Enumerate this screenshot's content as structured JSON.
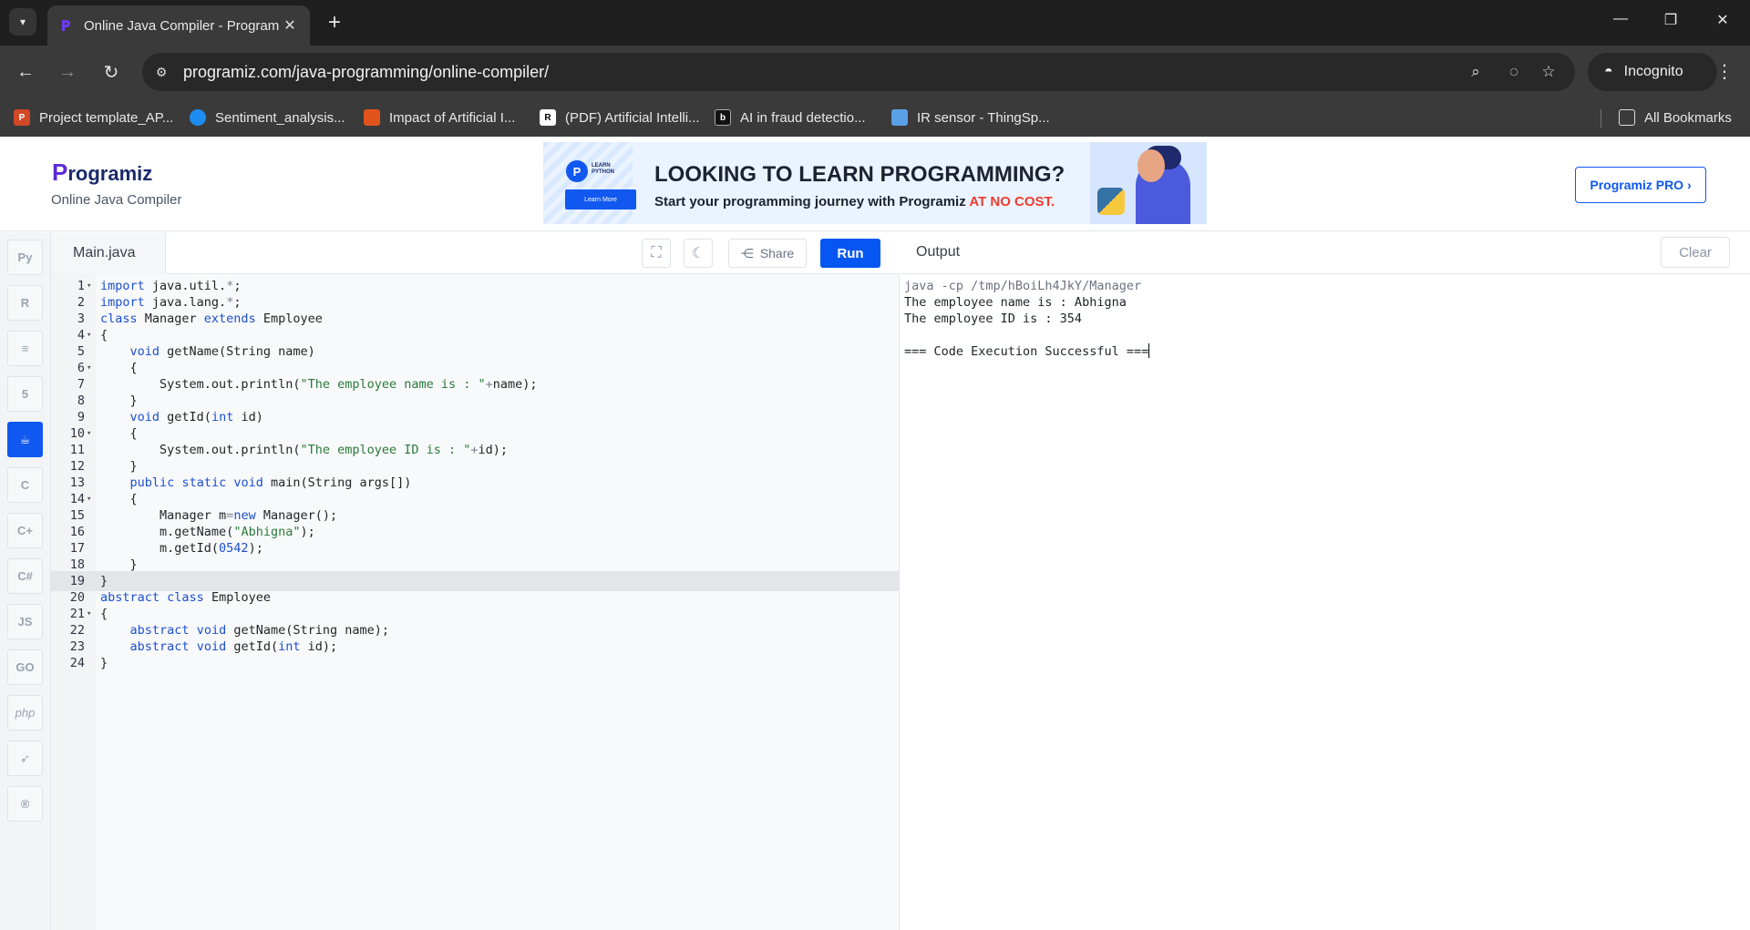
{
  "browser": {
    "tab_title": "Online Java Compiler - Program",
    "url": "programiz.com/java-programming/online-compiler/",
    "incognito_label": "Incognito",
    "all_bookmarks_label": "All Bookmarks",
    "bookmarks": [
      {
        "label": "Project template_AP...",
        "color": "#d24726"
      },
      {
        "label": "Sentiment_analysis...",
        "color": "#1d8cf0"
      },
      {
        "label": "Impact of Artificial I...",
        "color": "#e0541c"
      },
      {
        "label": "(PDF) Artificial Intelli...",
        "color": "#ffffff"
      },
      {
        "label": "AI in fraud detectio...",
        "color": "#111111"
      },
      {
        "label": "IR sensor - ThingSp...",
        "color": "#5aa0e6"
      }
    ]
  },
  "header": {
    "logo_text": "rogramiz",
    "logo_p": "P",
    "subtitle": "Online Java Compiler",
    "banner": {
      "logo_text": "LEARN PYTHON",
      "button": "Learn More",
      "headline": "LOOKING TO LEARN PROGRAMMING?",
      "sub_plain": "Start your programming journey with Programiz ",
      "sub_highlight": "AT NO COST."
    },
    "pro_button": "Programiz PRO ›"
  },
  "languages": [
    {
      "name": "python-icon",
      "glyph": "Py"
    },
    {
      "name": "r-icon",
      "glyph": "R"
    },
    {
      "name": "sql-icon",
      "glyph": "≡"
    },
    {
      "name": "html-icon",
      "glyph": "5"
    },
    {
      "name": "java-icon",
      "glyph": "☕",
      "active": true
    },
    {
      "name": "c-icon",
      "glyph": "C"
    },
    {
      "name": "cpp-icon",
      "glyph": "C+"
    },
    {
      "name": "csharp-icon",
      "glyph": "C#"
    },
    {
      "name": "javascript-icon",
      "glyph": "JS"
    },
    {
      "name": "go-icon",
      "glyph": "GO"
    },
    {
      "name": "php-icon",
      "glyph": "php"
    },
    {
      "name": "swift-icon",
      "glyph": "➶"
    },
    {
      "name": "rust-icon",
      "glyph": "R"
    }
  ],
  "editor": {
    "file_name": "Main.java",
    "share_label": "Share",
    "run_label": "Run",
    "active_line": 19,
    "lines": [
      {
        "n": "1",
        "fold": true,
        "html": "<span class=\"kw\">import</span> java.util.<span class=\"op\">*</span>;"
      },
      {
        "n": "2",
        "fold": false,
        "html": "<span class=\"kw\">import</span> java.lang.<span class=\"op\">*</span>;"
      },
      {
        "n": "3",
        "fold": false,
        "html": "<span class=\"kw\">class</span> Manager <span class=\"kw\">extends</span> Employee"
      },
      {
        "n": "4",
        "fold": true,
        "html": "{"
      },
      {
        "n": "5",
        "fold": false,
        "html": "    <span class=\"kw\">void</span> getName(String name)"
      },
      {
        "n": "6",
        "fold": true,
        "html": "    {"
      },
      {
        "n": "7",
        "fold": false,
        "html": "        System.out.println(<span class=\"str\">\"The employee name is : \"</span><span class=\"op\">+</span>name);"
      },
      {
        "n": "8",
        "fold": false,
        "html": "    }"
      },
      {
        "n": "9",
        "fold": false,
        "html": "    <span class=\"kw\">void</span> getId(<span class=\"kw\">int</span> id)"
      },
      {
        "n": "10",
        "fold": true,
        "html": "    {"
      },
      {
        "n": "11",
        "fold": false,
        "html": "        System.out.println(<span class=\"str\">\"The employee ID is : \"</span><span class=\"op\">+</span>id);"
      },
      {
        "n": "12",
        "fold": false,
        "html": "    }"
      },
      {
        "n": "13",
        "fold": false,
        "html": "    <span class=\"kw\">public</span> <span class=\"kw\">static</span> <span class=\"kw\">void</span> main(String args[])"
      },
      {
        "n": "14",
        "fold": true,
        "html": "    {"
      },
      {
        "n": "15",
        "fold": false,
        "html": "        Manager m<span class=\"op\">=</span><span class=\"kw\">new</span> Manager();"
      },
      {
        "n": "16",
        "fold": false,
        "html": "        m.getName(<span class=\"str\">\"Abhigna\"</span>);"
      },
      {
        "n": "17",
        "fold": false,
        "html": "        m.getId(<span class=\"num\">0542</span>);"
      },
      {
        "n": "18",
        "fold": false,
        "html": "    }"
      },
      {
        "n": "19",
        "fold": false,
        "html": "}"
      },
      {
        "n": "20",
        "fold": false,
        "html": "<span class=\"kw\">abstract</span> <span class=\"kw\">class</span> Employee"
      },
      {
        "n": "21",
        "fold": true,
        "html": "{"
      },
      {
        "n": "22",
        "fold": false,
        "html": "    <span class=\"kw\">abstract</span> <span class=\"kw\">void</span> getName(String name);"
      },
      {
        "n": "23",
        "fold": false,
        "html": "    <span class=\"kw\">abstract</span> <span class=\"kw\">void</span> getId(<span class=\"kw\">int</span> id);"
      },
      {
        "n": "24",
        "fold": false,
        "html": "}"
      }
    ]
  },
  "output": {
    "title": "Output",
    "clear_label": "Clear",
    "lines": [
      {
        "text": "java -cp /tmp/hBoiLh4JkY/Manager",
        "kind": "cmd"
      },
      {
        "text": "The employee name is : Abhigna",
        "kind": "out"
      },
      {
        "text": "The employee ID is : 354",
        "kind": "out"
      },
      {
        "text": "",
        "kind": "out"
      },
      {
        "text": "=== Code Execution Successful ===",
        "kind": "out",
        "cursor": true
      }
    ]
  }
}
